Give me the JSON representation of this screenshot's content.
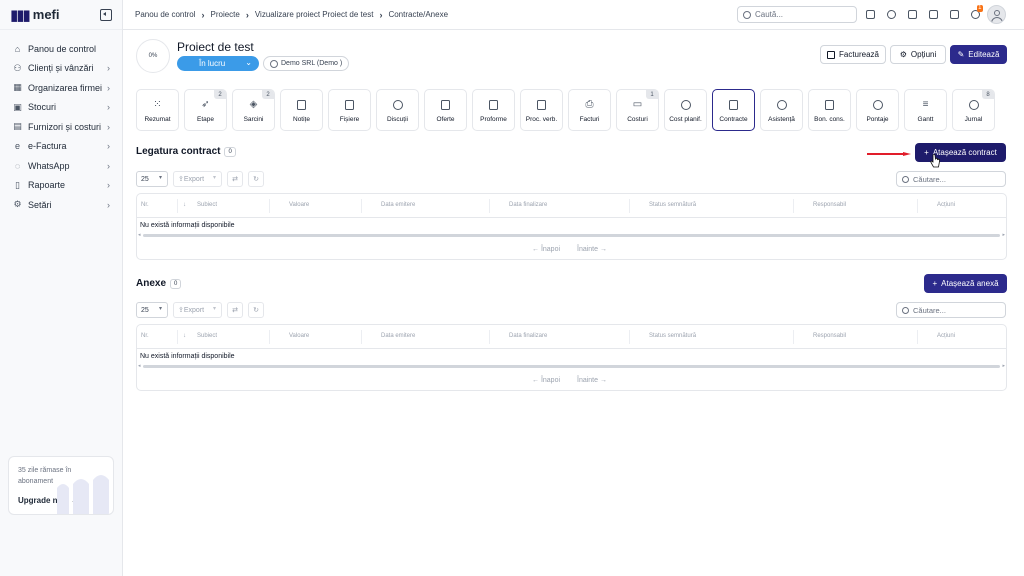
{
  "brand": {
    "name": "mefi",
    "accent": "#2c2a8c",
    "dark_accent": "#1e1b6b",
    "status_blue": "#3b9be8"
  },
  "sidebar": {
    "items": [
      {
        "label": "Panou de control",
        "icon": "home-icon",
        "chevron": false
      },
      {
        "label": "Clienți și vânzări",
        "icon": "users-icon",
        "chevron": true
      },
      {
        "label": "Organizarea firmei",
        "icon": "org-icon",
        "chevron": true
      },
      {
        "label": "Stocuri",
        "icon": "box-icon",
        "chevron": true
      },
      {
        "label": "Furnizori și costuri",
        "icon": "wallet-icon",
        "chevron": true
      },
      {
        "label": "e-Factura",
        "icon": "efactura-icon",
        "chevron": true
      },
      {
        "label": "WhatsApp",
        "icon": "whatsapp-icon",
        "chevron": true
      },
      {
        "label": "Rapoarte",
        "icon": "clipboard-icon",
        "chevron": true
      },
      {
        "label": "Setări",
        "icon": "gear-icon",
        "chevron": true
      }
    ],
    "promo": {
      "text": "35 zile rămase în abonament",
      "link": "Upgrade now"
    }
  },
  "topbar": {
    "breadcrumb": [
      "Panou de control",
      "Proiecte",
      "Vizualizare proiect Proiect de test",
      "Contracte/Anexe"
    ],
    "search_placeholder": "Caută...",
    "notification_count": "1"
  },
  "project": {
    "progress": "0%",
    "title": "Proiect de test",
    "status": "În lucru",
    "client": "Demo SRL (Demo )",
    "actions": {
      "invoice": "Facturează",
      "options": "Opțiuni",
      "edit": "Editează"
    }
  },
  "tabs": [
    {
      "label": "Rezumat",
      "icon": "grid-icon",
      "count": ""
    },
    {
      "label": "Etape",
      "icon": "rocket-icon",
      "count": "2"
    },
    {
      "label": "Sarcini",
      "icon": "layers-icon",
      "count": "2"
    },
    {
      "label": "Notițe",
      "icon": "note-icon",
      "count": ""
    },
    {
      "label": "Fișiere",
      "icon": "file-icon",
      "count": ""
    },
    {
      "label": "Discuții",
      "icon": "chat-icon",
      "count": ""
    },
    {
      "label": "Oferte",
      "icon": "document-icon",
      "count": ""
    },
    {
      "label": "Proforme",
      "icon": "document-icon",
      "count": ""
    },
    {
      "label": "Proc. verb.",
      "icon": "document-icon",
      "count": ""
    },
    {
      "label": "Facturi",
      "icon": "invoice-icon",
      "count": ""
    },
    {
      "label": "Costuri",
      "icon": "money-icon",
      "count": "1"
    },
    {
      "label": "Cost planif.",
      "icon": "piggy-bank-icon",
      "count": ""
    },
    {
      "label": "Contracte",
      "icon": "contract-icon",
      "count": "",
      "active": true
    },
    {
      "label": "Asistență",
      "icon": "lifebuoy-icon",
      "count": ""
    },
    {
      "label": "Bon. cons.",
      "icon": "document-icon",
      "count": ""
    },
    {
      "label": "Pontaje",
      "icon": "clock-icon",
      "count": ""
    },
    {
      "label": "Gantt",
      "icon": "gantt-icon",
      "count": ""
    },
    {
      "label": "Jurnal",
      "icon": "history-icon",
      "count": "8"
    }
  ],
  "contracts": {
    "title": "Legatura contract",
    "count": "0",
    "attach_label": "Atașează contract",
    "page_size": "25",
    "export_label": "Export",
    "search_placeholder": "Căutare...",
    "columns": [
      "Nr.",
      "Subiect",
      "Valoare",
      "Data emitere",
      "Data finalizare",
      "Status semnătură",
      "Responsabil",
      "Acțiuni"
    ],
    "empty_text": "Nu există informații disponibile",
    "prev": "← Înapoi",
    "next": "Înainte →"
  },
  "annexes": {
    "title": "Anexe",
    "count": "0",
    "attach_label": "Atașează anexă",
    "page_size": "25",
    "export_label": "Export",
    "search_placeholder": "Căutare...",
    "columns": [
      "Nr.",
      "Subiect",
      "Valoare",
      "Data emitere",
      "Data finalizare",
      "Status semnătură",
      "Responsabil",
      "Acțiuni"
    ],
    "empty_text": "Nu există informații disponibile",
    "prev": "← Înapoi",
    "next": "Înainte →"
  }
}
